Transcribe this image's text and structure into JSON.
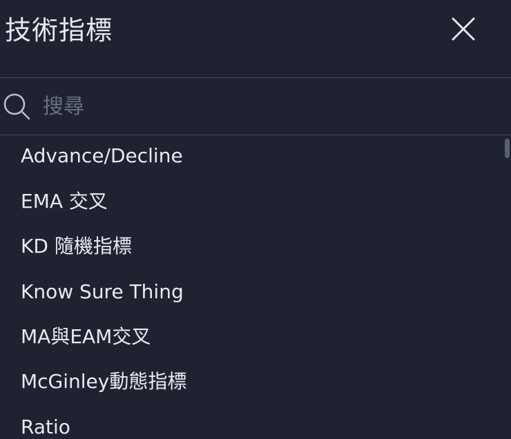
{
  "header": {
    "title": "技術指標",
    "close_icon": "close-icon"
  },
  "search": {
    "icon": "search-icon",
    "placeholder": "搜尋",
    "value": ""
  },
  "indicators": [
    {
      "label": "Advance/Decline"
    },
    {
      "label": "EMA 交叉"
    },
    {
      "label": "KD 隨機指標"
    },
    {
      "label": "Know Sure Thing"
    },
    {
      "label": "MA與EAM交叉"
    },
    {
      "label": "McGinley動態指標"
    },
    {
      "label": "Ratio"
    }
  ],
  "colors": {
    "background": "#1f2331",
    "text": "#e9ebf0",
    "divider": "#434857",
    "placeholder": "#6b7080",
    "scrollbar": "#5a5f6d"
  }
}
